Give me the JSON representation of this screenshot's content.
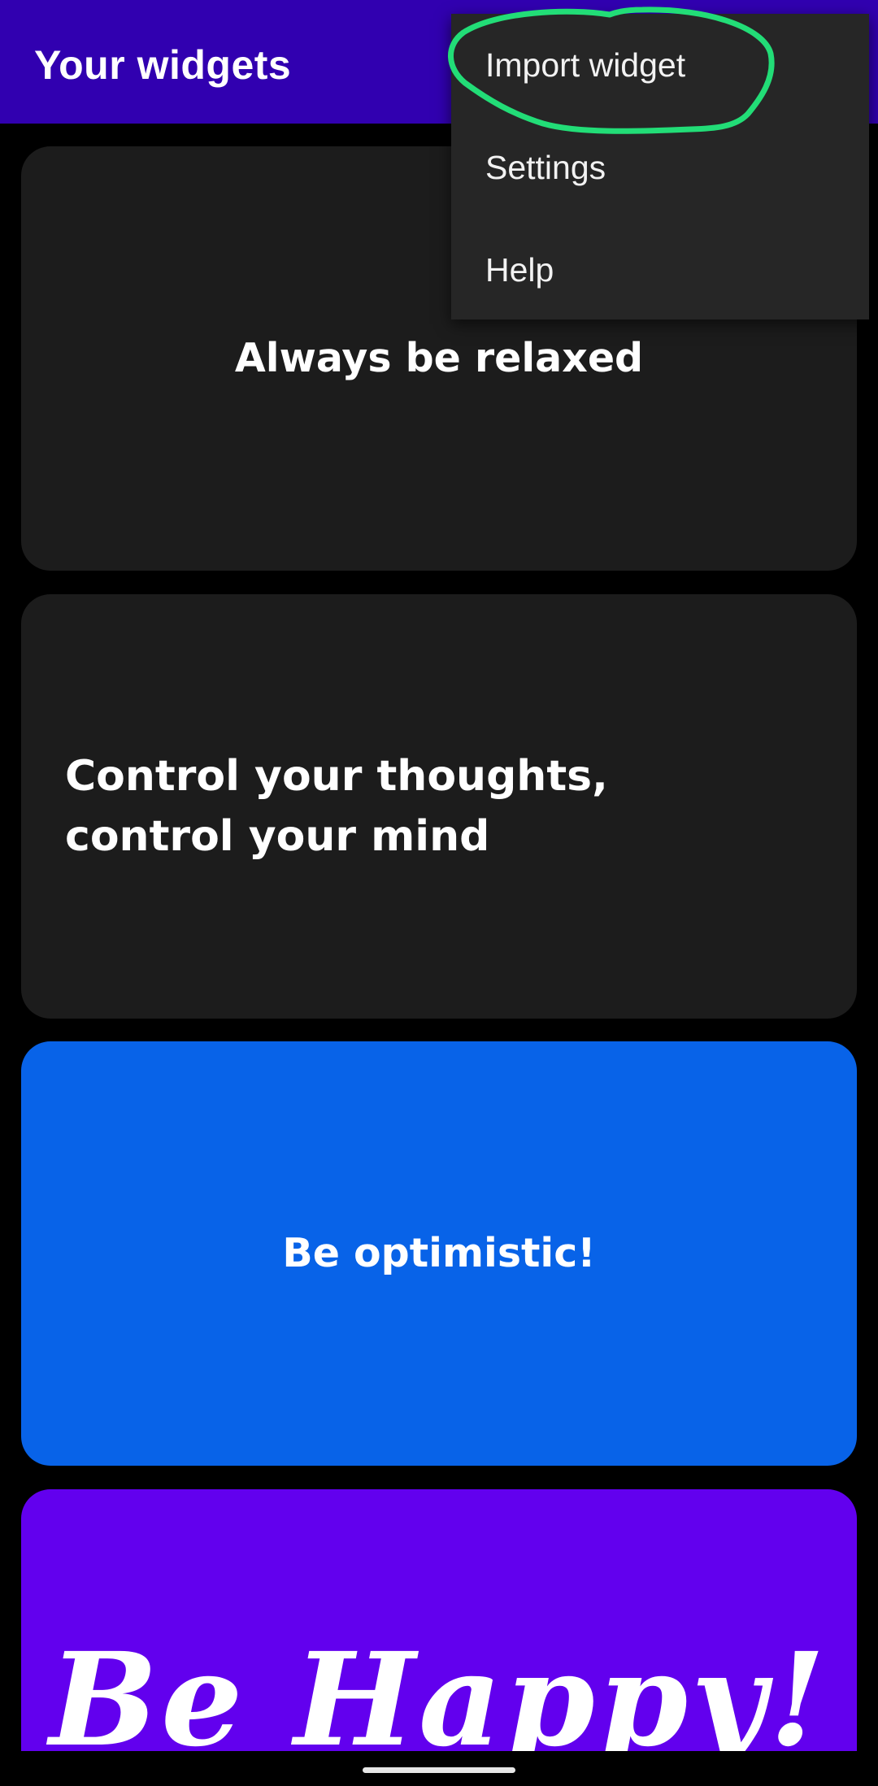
{
  "app_bar": {
    "title": "Your widgets",
    "background": "#3100b0"
  },
  "overflow_menu": {
    "items": [
      {
        "label": "Import widget",
        "highlighted": true
      },
      {
        "label": "Settings"
      },
      {
        "label": "Help"
      }
    ],
    "background": "#262626",
    "annotation_color": "#22dd77"
  },
  "widgets": [
    {
      "text": "Always be relaxed",
      "background": "#1c1c1c"
    },
    {
      "text": "Control your thoughts, control your mind",
      "background": "#1c1c1c"
    },
    {
      "text": "Be optimistic!",
      "background": "#0863e8"
    },
    {
      "text": "Be Happy!",
      "background": "#6200ee"
    }
  ]
}
